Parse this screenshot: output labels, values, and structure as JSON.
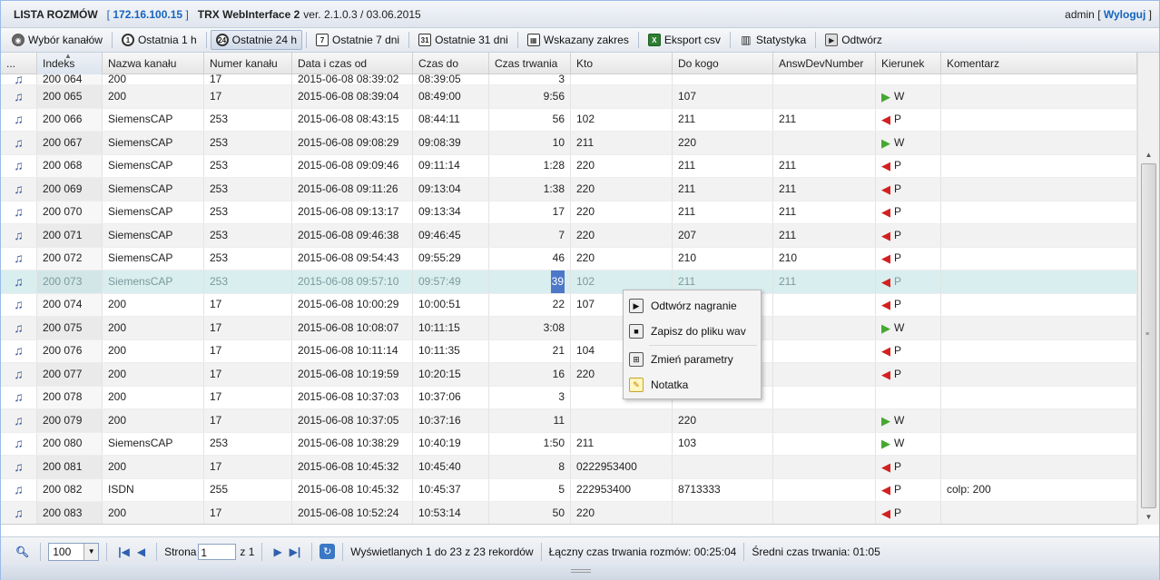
{
  "title": {
    "app_list": "LISTA ROZMÓW",
    "ip_open": "[",
    "ip": "172.16.100.15",
    "ip_close": "]",
    "app_name": "TRX WebInterface 2",
    "version": "ver. 2.1.0.3 / 03.06.2015",
    "user": "admin",
    "logout": "Wyloguj"
  },
  "toolbar": [
    {
      "label": "Wybór kanałów",
      "icon": "speaker-icon"
    },
    {
      "label": "Ostatnia 1 h",
      "icon": "clock-1h-icon",
      "glyph": "1"
    },
    {
      "label": "Ostatnie 24 h",
      "icon": "clock-24h-icon",
      "glyph": "24",
      "active": true
    },
    {
      "label": "Ostatnie 7 dni",
      "icon": "calendar-7-icon",
      "glyph": "7"
    },
    {
      "label": "Ostatnie 31 dni",
      "icon": "calendar-31-icon",
      "glyph": "31"
    },
    {
      "label": "Wskazany zakres",
      "icon": "calendar-range-icon",
      "glyph": "▦"
    },
    {
      "label": "Eksport csv",
      "icon": "excel-export-icon",
      "glyph": "X"
    },
    {
      "label": "Statystyka",
      "icon": "bar-chart-icon",
      "glyph": "▥"
    },
    {
      "label": "Odtwórz",
      "icon": "play-icon",
      "glyph": "▶"
    }
  ],
  "columns": [
    {
      "key": "icon",
      "label": "...",
      "width": 40
    },
    {
      "key": "idx",
      "label": "Indeks",
      "width": 72
    },
    {
      "key": "name",
      "label": "Nazwa kanału",
      "width": 112
    },
    {
      "key": "num",
      "label": "Numer kanału",
      "width": 97
    },
    {
      "key": "start",
      "label": "Data i czas od",
      "width": 133
    },
    {
      "key": "end",
      "label": "Czas do",
      "width": 84
    },
    {
      "key": "dur",
      "label": "Czas trwania",
      "width": 90
    },
    {
      "key": "from",
      "label": "Kto",
      "width": 112
    },
    {
      "key": "to",
      "label": "Do kogo",
      "width": 111
    },
    {
      "key": "answ",
      "label": "AnswDevNumber",
      "width": 113
    },
    {
      "key": "dir",
      "label": "Kierunek",
      "width": 72
    },
    {
      "key": "comment",
      "label": "Komentarz",
      "width": 216
    }
  ],
  "partial_row": {
    "idx": "200 064",
    "name": "200",
    "num": "17",
    "start": "2015-06-08 08:39:02",
    "end": "08:39:05",
    "dur": "3"
  },
  "rows": [
    {
      "idx": "200 065",
      "name": "200",
      "num": "17",
      "start": "2015-06-08 08:39:04",
      "end": "08:49:00",
      "dur": "9:56",
      "from": "",
      "to": "107",
      "answ": "",
      "dir": "W",
      "comment": ""
    },
    {
      "idx": "200 066",
      "name": "SiemensCAP",
      "num": "253",
      "start": "2015-06-08 08:43:15",
      "end": "08:44:11",
      "dur": "56",
      "from": "102",
      "to": "211",
      "answ": "211",
      "dir": "P",
      "comment": ""
    },
    {
      "idx": "200 067",
      "name": "SiemensCAP",
      "num": "253",
      "start": "2015-06-08 09:08:29",
      "end": "09:08:39",
      "dur": "10",
      "from": "211",
      "to": "220",
      "answ": "",
      "dir": "W",
      "comment": ""
    },
    {
      "idx": "200 068",
      "name": "SiemensCAP",
      "num": "253",
      "start": "2015-06-08 09:09:46",
      "end": "09:11:14",
      "dur": "1:28",
      "from": "220",
      "to": "211",
      "answ": "211",
      "dir": "P",
      "comment": ""
    },
    {
      "idx": "200 069",
      "name": "SiemensCAP",
      "num": "253",
      "start": "2015-06-08 09:11:26",
      "end": "09:13:04",
      "dur": "1:38",
      "from": "220",
      "to": "211",
      "answ": "211",
      "dir": "P",
      "comment": ""
    },
    {
      "idx": "200 070",
      "name": "SiemensCAP",
      "num": "253",
      "start": "2015-06-08 09:13:17",
      "end": "09:13:34",
      "dur": "17",
      "from": "220",
      "to": "211",
      "answ": "211",
      "dir": "P",
      "comment": ""
    },
    {
      "idx": "200 071",
      "name": "SiemensCAP",
      "num": "253",
      "start": "2015-06-08 09:46:38",
      "end": "09:46:45",
      "dur": "7",
      "from": "220",
      "to": "207",
      "answ": "211",
      "dir": "P",
      "comment": ""
    },
    {
      "idx": "200 072",
      "name": "SiemensCAP",
      "num": "253",
      "start": "2015-06-08 09:54:43",
      "end": "09:55:29",
      "dur": "46",
      "from": "220",
      "to": "210",
      "answ": "210",
      "dir": "P",
      "comment": ""
    },
    {
      "idx": "200 073",
      "name": "SiemensCAP",
      "num": "253",
      "start": "2015-06-08 09:57:10",
      "end": "09:57:49",
      "dur": "39",
      "from": "102",
      "to": "211",
      "answ": "211",
      "dir": "P",
      "comment": "",
      "selected": true
    },
    {
      "idx": "200 074",
      "name": "200",
      "num": "17",
      "start": "2015-06-08 10:00:29",
      "end": "10:00:51",
      "dur": "22",
      "from": "107",
      "to": "",
      "answ": "",
      "dir": "P",
      "comment": ""
    },
    {
      "idx": "200 075",
      "name": "200",
      "num": "17",
      "start": "2015-06-08 10:08:07",
      "end": "10:11:15",
      "dur": "3:08",
      "from": "",
      "to": "",
      "answ": "",
      "dir": "W",
      "comment": ""
    },
    {
      "idx": "200 076",
      "name": "200",
      "num": "17",
      "start": "2015-06-08 10:11:14",
      "end": "10:11:35",
      "dur": "21",
      "from": "104",
      "to": "",
      "answ": "",
      "dir": "P",
      "comment": ""
    },
    {
      "idx": "200 077",
      "name": "200",
      "num": "17",
      "start": "2015-06-08 10:19:59",
      "end": "10:20:15",
      "dur": "16",
      "from": "220",
      "to": "",
      "answ": "",
      "dir": "P",
      "comment": ""
    },
    {
      "idx": "200 078",
      "name": "200",
      "num": "17",
      "start": "2015-06-08 10:37:03",
      "end": "10:37:06",
      "dur": "3",
      "from": "",
      "to": "",
      "answ": "",
      "dir": "",
      "comment": ""
    },
    {
      "idx": "200 079",
      "name": "200",
      "num": "17",
      "start": "2015-06-08 10:37:05",
      "end": "10:37:16",
      "dur": "11",
      "from": "",
      "to": "220",
      "answ": "",
      "dir": "W",
      "comment": ""
    },
    {
      "idx": "200 080",
      "name": "SiemensCAP",
      "num": "253",
      "start": "2015-06-08 10:38:29",
      "end": "10:40:19",
      "dur": "1:50",
      "from": "211",
      "to": "103",
      "answ": "",
      "dir": "W",
      "comment": ""
    },
    {
      "idx": "200 081",
      "name": "200",
      "num": "17",
      "start": "2015-06-08 10:45:32",
      "end": "10:45:40",
      "dur": "8",
      "from": "0222953400",
      "to": "",
      "answ": "",
      "dir": "P",
      "comment": ""
    },
    {
      "idx": "200 082",
      "name": "ISDN",
      "num": "255",
      "start": "2015-06-08 10:45:32",
      "end": "10:45:37",
      "dur": "5",
      "from": "222953400",
      "to": "8713333",
      "answ": "",
      "dir": "P",
      "comment": "colp: 200"
    },
    {
      "idx": "200 083",
      "name": "200",
      "num": "17",
      "start": "2015-06-08 10:52:24",
      "end": "10:53:14",
      "dur": "50",
      "from": "220",
      "to": "",
      "answ": "",
      "dir": "P",
      "comment": ""
    }
  ],
  "context_menu": [
    {
      "label": "Odtwórz nagranie",
      "icon": "play-icon",
      "glyph": "▶"
    },
    {
      "label": "Zapisz do pliku wav",
      "icon": "save-disk-icon",
      "glyph": "■"
    },
    {
      "label": "Zmień parametry",
      "icon": "edit-params-icon",
      "glyph": "⊞"
    },
    {
      "label": "Notatka",
      "icon": "note-pencil-icon",
      "glyph": "✎"
    }
  ],
  "pager": {
    "page_size": "100",
    "page_label": "Strona",
    "page_value": "1",
    "page_of": "z 1",
    "display_info": "Wyświetlanych 1 do 23 z 23 rekordów",
    "total_duration": "Łączny czas trwania rozmów: 00:25:04",
    "avg_duration": "Średni czas trwania: 01:05"
  },
  "colors": {
    "accent": "#1565c0",
    "selected_row": "#d9eeef",
    "incoming_arrow": "#d32020",
    "outgoing_arrow": "#45a82f"
  }
}
